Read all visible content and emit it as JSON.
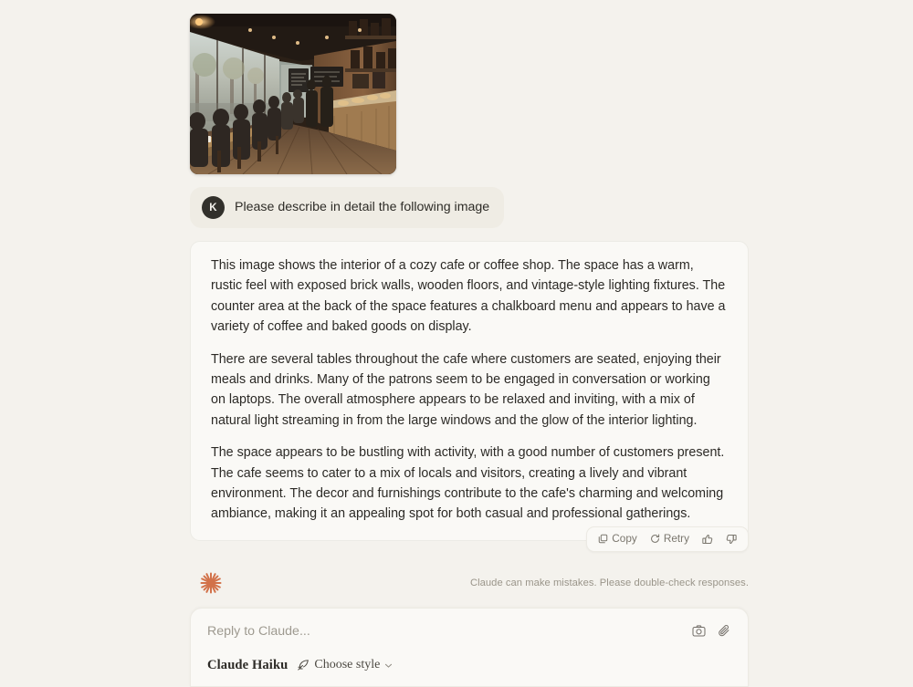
{
  "app": {
    "background_color": "#f4f2ed",
    "accent_color": "#d2724a"
  },
  "attachment": {
    "icon": "image-thumbnail",
    "alt": "Interior photograph of a cozy cafe with brick walls, wooden floors, large street-facing windows, seated customers and a counter with chalkboard menu"
  },
  "user_message": {
    "avatar_initial": "K",
    "text": "Please describe in detail the following image"
  },
  "assistant_message": {
    "paragraphs": [
      "This image shows the interior of a cozy cafe or coffee shop. The space has a warm, rustic feel with exposed brick walls, wooden floors, and vintage-style lighting fixtures. The counter area at the back of the space features a chalkboard menu and appears to have a variety of coffee and baked goods on display.",
      "There are several tables throughout the cafe where customers are seated, enjoying their meals and drinks. Many of the patrons seem to be engaged in conversation or working on laptops. The overall atmosphere appears to be relaxed and inviting, with a mix of natural light streaming in from the large windows and the glow of the interior lighting.",
      "The space appears to be bustling with activity, with a good number of customers present. The cafe seems to cater to a mix of locals and visitors, creating a lively and vibrant environment. The decor and furnishings contribute to the cafe's charming and welcoming ambiance, making it an appealing spot for both casual and professional gatherings."
    ]
  },
  "actions": {
    "copy_label": "Copy",
    "retry_label": "Retry",
    "thumbs_up_icon": "thumbs-up-icon",
    "thumbs_down_icon": "thumbs-down-icon"
  },
  "footer": {
    "logo_icon": "claude-starburst-logo",
    "disclaimer": "Claude can make mistakes. Please double-check responses."
  },
  "composer": {
    "placeholder": "Reply to Claude...",
    "value": "",
    "camera_icon": "camera-icon",
    "attach_icon": "paperclip-icon",
    "model_name": "Claude Haiku",
    "style_label": "Choose style",
    "style_icon": "quill-pen-icon",
    "chevron_icon": "chevron-down-icon"
  }
}
